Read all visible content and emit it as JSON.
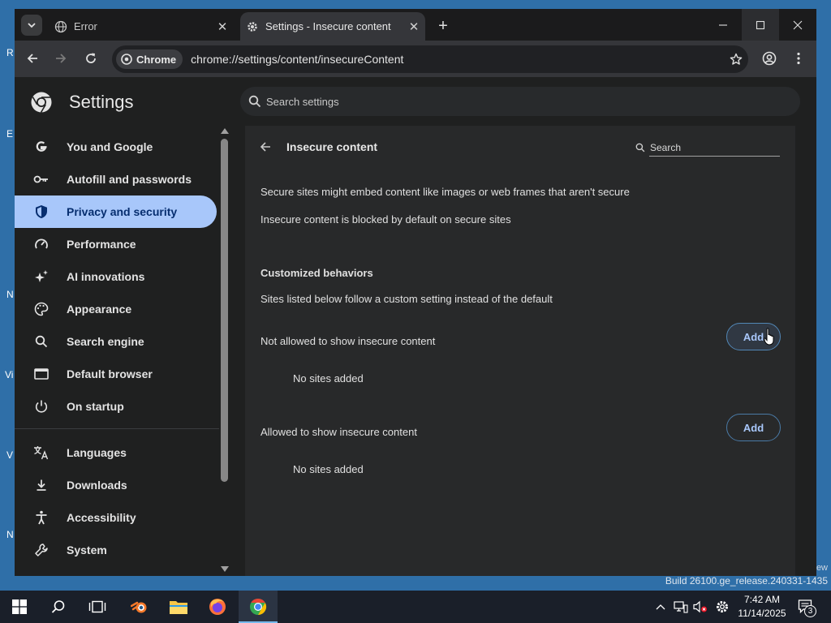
{
  "desktop": {
    "edge_letters": [
      "R",
      "E",
      "N",
      "Vi",
      "V",
      "N"
    ],
    "build_text": "Build 26100.ge_release.240331-1435",
    "right_text": "ew"
  },
  "tabs": [
    {
      "title": "Error",
      "active": false
    },
    {
      "title": "Settings - Insecure content",
      "active": true
    }
  ],
  "toolbar": {
    "chip_label": "Chrome",
    "url": "chrome://settings/content/insecureContent"
  },
  "header": {
    "title": "Settings",
    "search_placeholder": "Search settings"
  },
  "sidebar": {
    "items": [
      {
        "label": "You and Google",
        "icon": "google-g-icon"
      },
      {
        "label": "Autofill and passwords",
        "icon": "key-icon"
      },
      {
        "label": "Privacy and security",
        "icon": "shield-icon",
        "selected": true
      },
      {
        "label": "Performance",
        "icon": "speedometer-icon"
      },
      {
        "label": "AI innovations",
        "icon": "sparkle-icon"
      },
      {
        "label": "Appearance",
        "icon": "palette-icon"
      },
      {
        "label": "Search engine",
        "icon": "search-icon"
      },
      {
        "label": "Default browser",
        "icon": "browser-window-icon"
      },
      {
        "label": "On startup",
        "icon": "power-icon"
      },
      {
        "label": "Languages",
        "icon": "translate-icon"
      },
      {
        "label": "Downloads",
        "icon": "download-icon"
      },
      {
        "label": "Accessibility",
        "icon": "accessibility-icon"
      },
      {
        "label": "System",
        "icon": "wrench-icon"
      }
    ]
  },
  "main": {
    "title": "Insecure content",
    "search_placeholder": "Search",
    "description_1": "Secure sites might embed content like images or web frames that aren't secure",
    "description_2": "Insecure content is blocked by default on secure sites",
    "customized_heading": "Customized behaviors",
    "customized_desc": "Sites listed below follow a custom setting instead of the default",
    "not_allowed": {
      "label": "Not allowed to show insecure content",
      "button": "Add",
      "empty": "No sites added"
    },
    "allowed": {
      "label": "Allowed to show insecure content",
      "button": "Add",
      "empty": "No sites added"
    }
  },
  "taskbar": {
    "apps": [
      "start-icon",
      "search-icon",
      "task-view-icon",
      "blender-icon",
      "file-explorer-icon",
      "firefox-icon",
      "chrome-icon"
    ],
    "time": "7:42 AM",
    "date": "11/14/2025",
    "notification_count": "3"
  },
  "colors": {
    "accent": "#a8c7fa",
    "selected_text": "#062e6f",
    "page_bg": "#1f2020",
    "card_bg": "#28292a"
  }
}
